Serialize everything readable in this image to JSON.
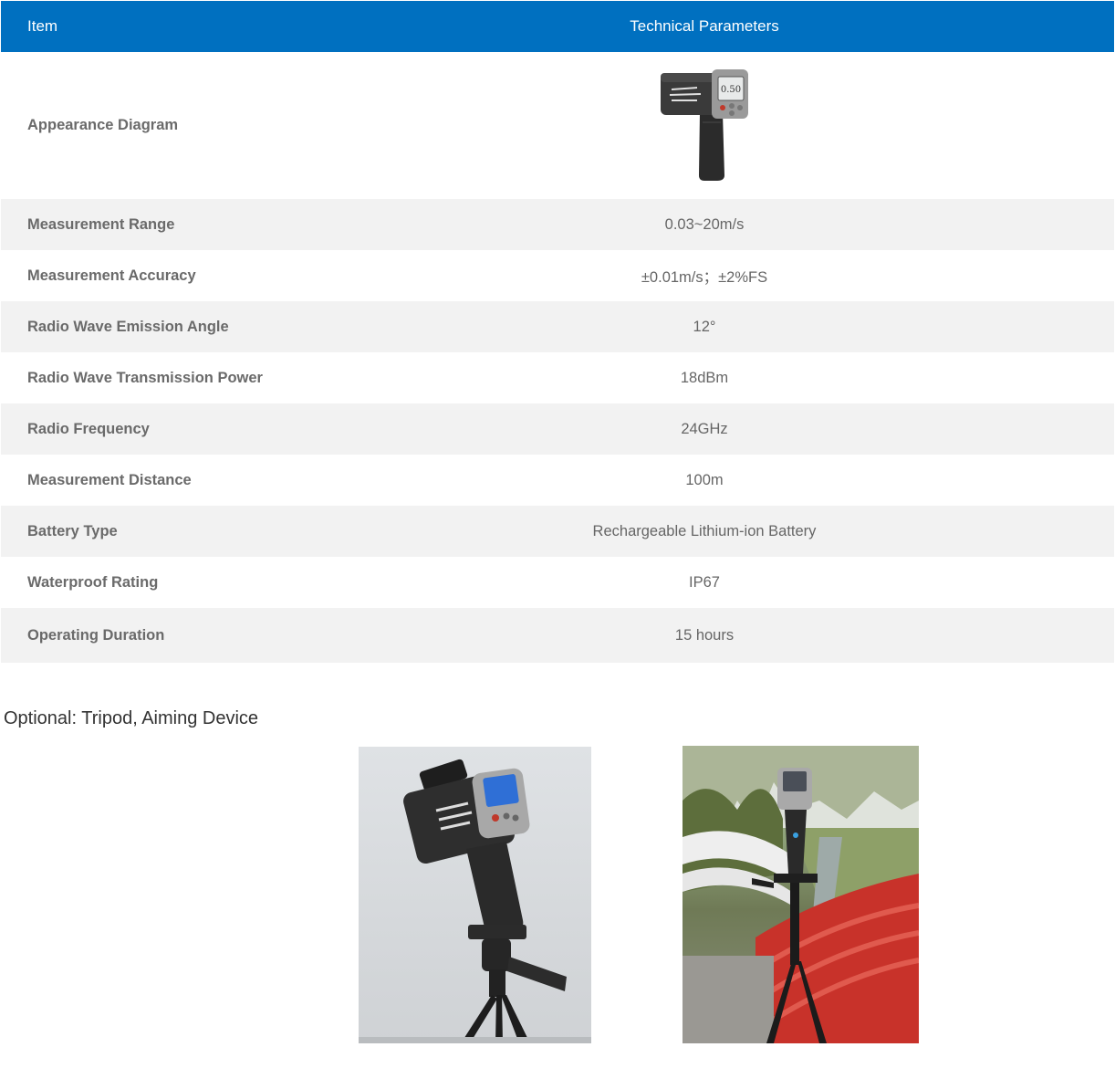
{
  "table": {
    "header": {
      "item": "Item",
      "parameters": "Technical Parameters"
    },
    "appearance_label": "Appearance Diagram",
    "device_screen_value": "0.50",
    "rows": [
      {
        "label": "Measurement Range",
        "value": "0.03~20m/s"
      },
      {
        "label": "Measurement Accuracy",
        "value": "±0.01m/s；±2%FS"
      },
      {
        "label": "Radio Wave Emission Angle",
        "value": "12°"
      },
      {
        "label": "Radio Wave Transmission Power",
        "value": "18dBm"
      },
      {
        "label": "Radio Frequency",
        "value": "24GHz"
      },
      {
        "label": "Measurement Distance",
        "value": "100m"
      },
      {
        "label": "Battery Type",
        "value": "Rechargeable Lithium-ion Battery"
      },
      {
        "label": "Waterproof Rating",
        "value": "IP67"
      },
      {
        "label": "Operating Duration",
        "value": "15 hours"
      }
    ]
  },
  "optional": {
    "caption": "Optional: Tripod, Aiming Device"
  },
  "colors": {
    "header_bg": "#0070c0",
    "row_alt": "#f2f2f2",
    "bridge_red": "#c8322a"
  },
  "icons": [
    "radar-gun-image",
    "tripod-photo-studio",
    "tripod-photo-bridge"
  ]
}
